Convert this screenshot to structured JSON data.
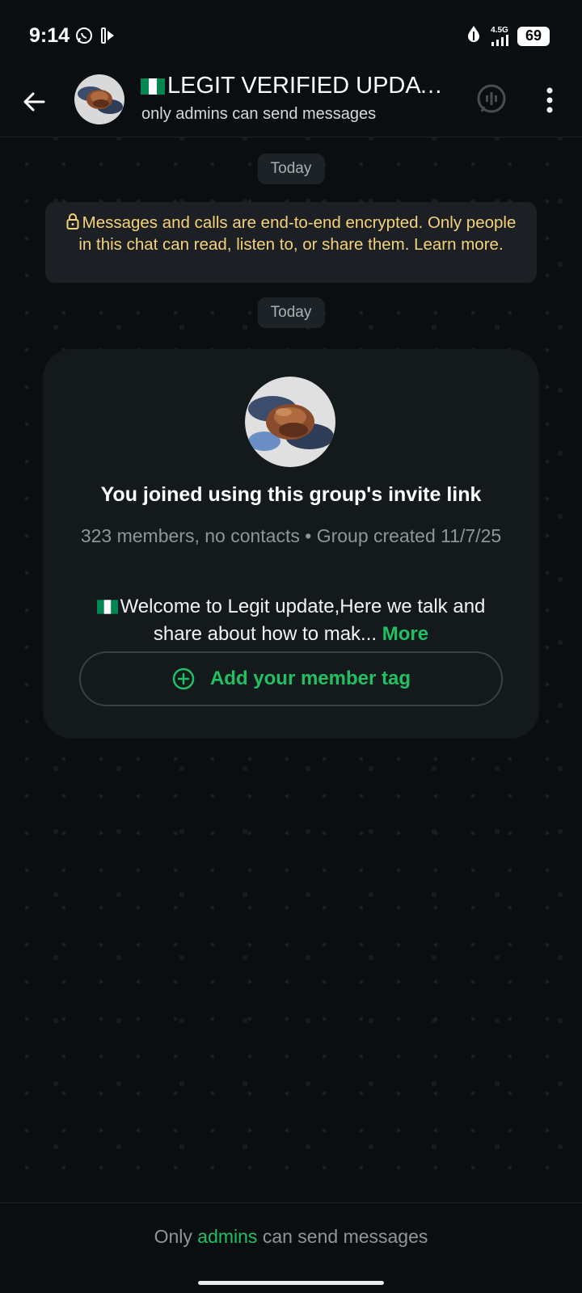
{
  "status_bar": {
    "time": "9:14",
    "network": "4.5G",
    "battery": "69",
    "icons": [
      "whatsapp-icon",
      "cast-icon",
      "drop-icon",
      "signal-icon",
      "battery-icon"
    ]
  },
  "header": {
    "title": "LEGIT VERIFIED UPDATE...",
    "subtitle": "only admins can send messages",
    "flag_icon": "nigeria-flag-icon"
  },
  "chat": {
    "date_chip_1": "Today",
    "encryption_notice": "Messages and calls are end-to-end encrypted. Only people in this chat can read, listen to, or share them. Learn more.",
    "date_chip_2": "Today",
    "group_card": {
      "title": "You joined using this group's invite link",
      "meta": "323 members, no contacts • Group created 11/7/25",
      "description": "Welcome to Legit update,Here we talk and share about how to mak...",
      "more_label": "More",
      "member_tag_label": "Add your member tag"
    }
  },
  "footer": {
    "prefix": "Only",
    "admins": "admins",
    "suffix": "can send messages"
  },
  "colors": {
    "background": "#0b0e11",
    "accent_green": "#21c063",
    "encryption_text": "#f5d27a",
    "card_bg": "#14191c"
  }
}
